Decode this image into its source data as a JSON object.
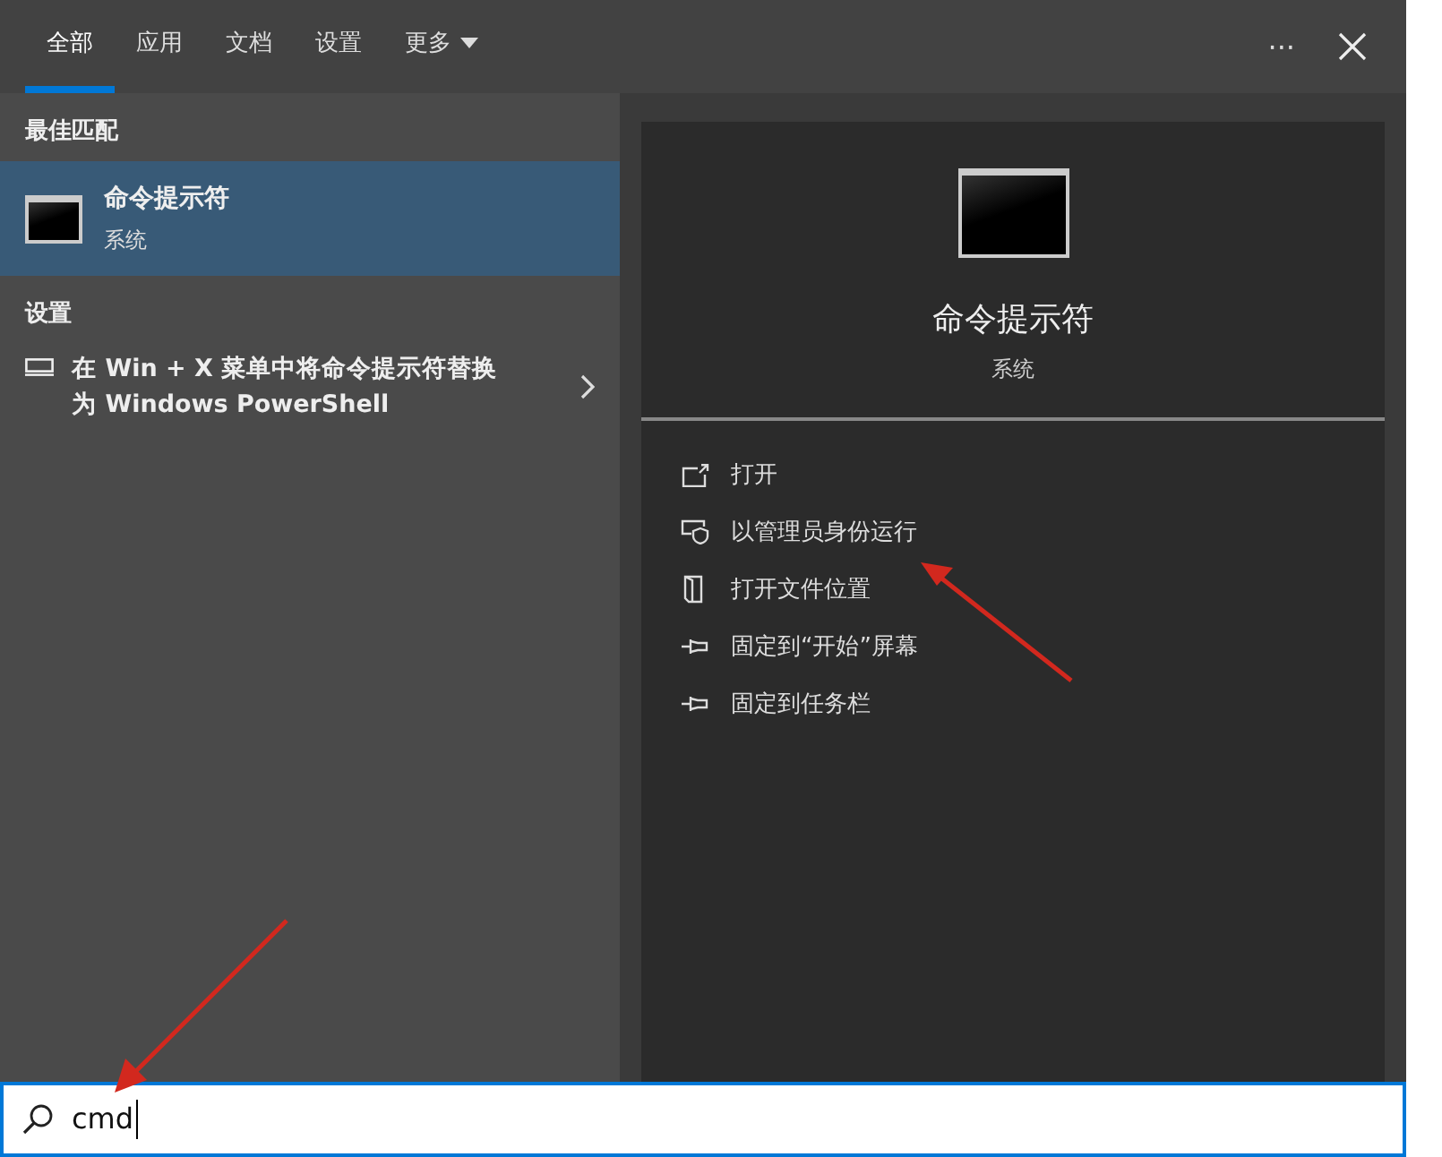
{
  "tabs": [
    {
      "label": "全部",
      "selected": true
    },
    {
      "label": "应用",
      "selected": false
    },
    {
      "label": "文档",
      "selected": false
    },
    {
      "label": "设置",
      "selected": false
    },
    {
      "label": "更多",
      "selected": false,
      "kind": "dropdown"
    }
  ],
  "header_actions": {
    "more": "···"
  },
  "best_match": {
    "heading": "最佳匹配",
    "title": "命令提示符",
    "subtitle": "系统",
    "selected": true
  },
  "settings": {
    "heading": "设置",
    "items": [
      {
        "text": "在 Win + X 菜单中将命令提示符替换为 Windows PowerShell"
      }
    ]
  },
  "detail": {
    "title": "命令提示符",
    "subtitle": "系统",
    "actions": [
      {
        "kind": "open",
        "label": "打开"
      },
      {
        "kind": "admin",
        "label": "以管理员身份运行"
      },
      {
        "kind": "folder",
        "label": "打开文件位置"
      },
      {
        "kind": "pin",
        "label": "固定到“开始”屏幕"
      },
      {
        "kind": "pin",
        "label": "固定到任务栏"
      }
    ]
  },
  "search": {
    "value": "cmd"
  }
}
